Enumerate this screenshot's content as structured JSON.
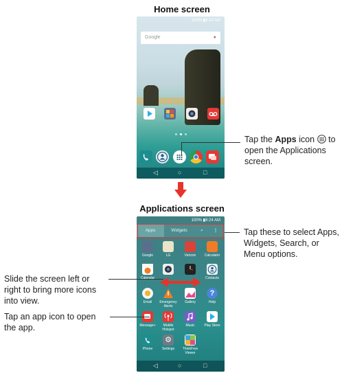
{
  "home": {
    "title": "Home screen",
    "status": "100% ▮8:24 AM",
    "search_placeholder": "Google",
    "mic": "🎤"
  },
  "callouts": {
    "apps_icon_prefix": "Tap the ",
    "apps_bold": "Apps",
    "apps_icon_suffix": " icon",
    "apps_icon_rest": " to",
    "apps_line2": "open the Applications",
    "apps_line3": "screen.",
    "tap_these_l1": "Tap these to select Apps,",
    "tap_these_l2": "Widgets, Search, or",
    "tap_these_l3": "Menu options.",
    "slide_l1": "Slide the screen left or",
    "slide_l2": "right to bring more icons",
    "slide_l3": "into view.",
    "tap_app_l1": "Tap an app icon to open",
    "tap_app_l2": "the app."
  },
  "apps": {
    "title": "Applications screen",
    "status": "100% ▮8:24 AM",
    "tabs": {
      "apps": "Apps",
      "widgets": "Widgets"
    },
    "labels": [
      "Google",
      "LG",
      "Verizon",
      "Calculator",
      "Calendar",
      "",
      "",
      "Contacts",
      "Email",
      "Emergency Alerts",
      "Gallery",
      "Help",
      "Message+",
      "Mobile Hotspot",
      "Music",
      "Play Store",
      "Phone",
      "Settings",
      "ThinkFree Viewer"
    ]
  },
  "nav": {
    "back": "◁",
    "home": "○",
    "recent": "□"
  },
  "colors": {
    "arrow": "#e8332a",
    "highlight": "#e33",
    "navbar": "#0e5c60",
    "appsbar": "#4d8c8e"
  }
}
